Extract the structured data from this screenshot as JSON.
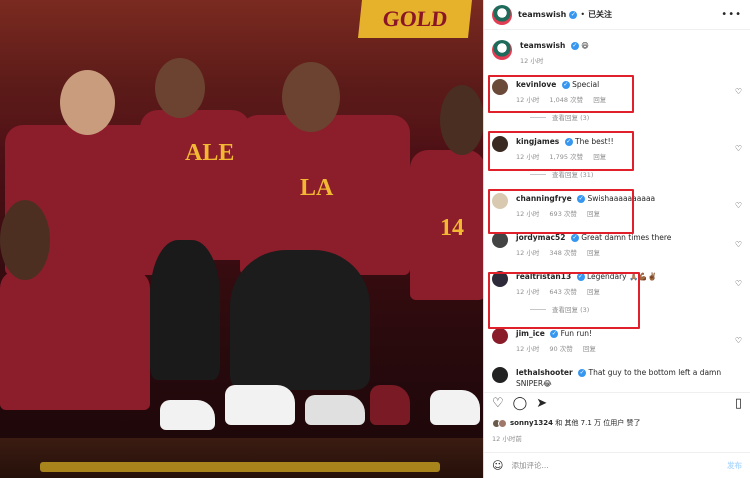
{
  "photo": {
    "sign_text": "GOLD",
    "jersey_labels": [
      "ALE",
      "LA",
      "14"
    ]
  },
  "header": {
    "username": "teamswish",
    "follow_label": "已关注",
    "more_label": "•••"
  },
  "caption": {
    "username": "teamswish",
    "emoji": "😄",
    "time": "12 小时"
  },
  "comments": [
    {
      "username": "kevinlove",
      "verified": true,
      "text": "Special",
      "time": "12 小时",
      "likes": "1,048 次赞",
      "reply": "回复",
      "replies": "查看回复 (3)"
    },
    {
      "username": "kingjames",
      "verified": true,
      "text": "The best!!",
      "time": "12 小时",
      "likes": "1,795 次赞",
      "reply": "回复",
      "replies": "查看回复 (31)"
    },
    {
      "username": "channingfrye",
      "verified": true,
      "text": "Swishaaaaaaaaaa",
      "time": "12 小时",
      "likes": "693 次赞",
      "reply": "回复",
      "replies": ""
    },
    {
      "username": "jordymac52",
      "verified": true,
      "text": "Great damn times there",
      "time": "12 小时",
      "likes": "348 次赞",
      "reply": "回复",
      "replies": ""
    },
    {
      "username": "realtristan13",
      "verified": true,
      "text": "Legendary 🙏🏽💪🏾✌🏾",
      "time": "12 小时",
      "likes": "643 次赞",
      "reply": "回复",
      "replies": "查看回复 (3)"
    },
    {
      "username": "jim_ice",
      "verified": true,
      "text": "Fun run!",
      "time": "12 小时",
      "likes": "90 次赞",
      "reply": "回复",
      "replies": ""
    },
    {
      "username": "lethalshooter",
      "verified": true,
      "text": "That guy to the bottom left a damn SNIPER😂",
      "time": "",
      "likes": "",
      "reply": "",
      "replies": ""
    }
  ],
  "likes_line": {
    "user": "sonny1324",
    "rest": "和 其他 7.1 万 位用户 赞了"
  },
  "post_time": "12 小时前",
  "add_comment": {
    "placeholder": "添加评论...",
    "post_label": "发布"
  },
  "icons": {
    "heart": "heart-icon",
    "comment": "comment-icon",
    "share": "share-icon",
    "bookmark": "bookmark-icon",
    "emoji": "emoji-icon"
  },
  "colors": {
    "highlight": "#e0202a",
    "verified": "#3797f0",
    "jersey": "#8c1d2b",
    "gold": "#f2b733"
  }
}
